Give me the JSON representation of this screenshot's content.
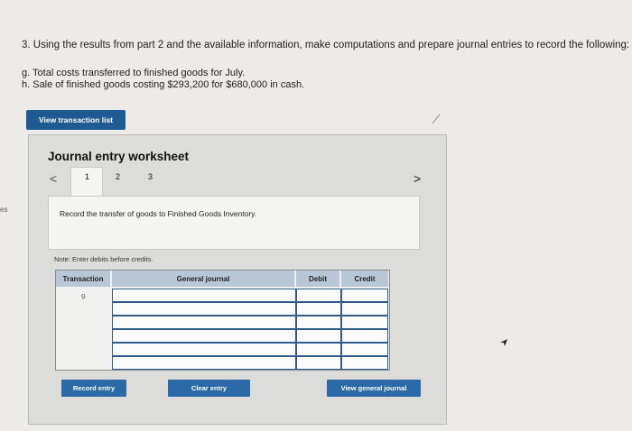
{
  "question": {
    "title": "3. Using the results from part 2 and the available information, make computations and prepare journal entries to record the following:",
    "item_g": "g. Total costs transferred to finished goods for July.",
    "item_h": "h. Sale of finished goods costing $293,200 for $680,000 in cash."
  },
  "edge_text": "es",
  "view_transaction_label": "View transaction list",
  "worksheet": {
    "title": "Journal entry worksheet",
    "nav_prev": "<",
    "nav_next": ">",
    "tabs": [
      "1",
      "2",
      "3"
    ],
    "instruction": "Record the transfer of goods to Finished Goods Inventory.",
    "note": "Note: Enter debits before credits.",
    "columns": [
      "Transaction",
      "General journal",
      "Debit",
      "Credit"
    ],
    "first_transaction": "g.",
    "buttons": {
      "record": "Record entry",
      "clear": "Clear entry",
      "view_journal": "View general journal"
    }
  }
}
